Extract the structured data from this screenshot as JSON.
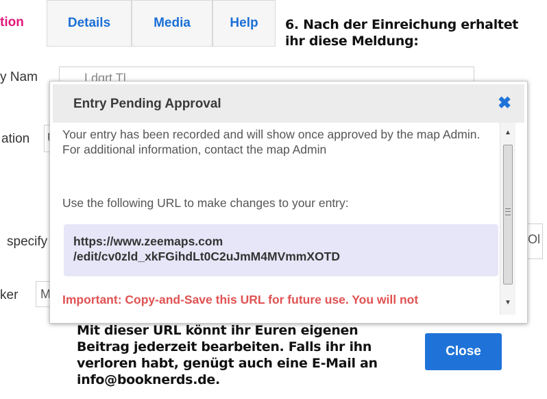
{
  "tabs": [
    {
      "label": "tion",
      "active": true
    },
    {
      "label": "Details",
      "active": false
    },
    {
      "label": "Media",
      "active": false
    },
    {
      "label": "Help",
      "active": false
    }
  ],
  "annotation_top": "6. Nach der Einreichung erhaltet ihr diese Meldung:",
  "annotation_bottom": "Mit dieser URL könnt ihr Euren eigenen Beitrag jederzeit bearbeiten. Falls ihr ihn verloren habt, genügt auch eine E-Mail an info@booknerds.de.",
  "form": {
    "name_label": "y Nam",
    "name_value": "Ldgrt Tl...",
    "location_label": "ation",
    "location_value": "U",
    "specify_label": "specify",
    "specify_value": "Ol",
    "marker_label": "ker",
    "marker_value": "M"
  },
  "dialog": {
    "title": "Entry Pending Approval",
    "close_icon": "close-icon",
    "intro": "Your entry has been recorded and will show once approved by the map Admin. For additional information, contact the map Admin",
    "url_intro": "Use the following URL to make changes to your entry:",
    "url_line1": "https://www.zeemaps.com",
    "url_line2": "/edit/cv0zld_xkFGihdLt0C2uJmM4MVmmXOTD",
    "important": "Important: Copy-and-Save this URL for future use. You will not",
    "close_button": "Close"
  },
  "colors": {
    "accent": "#1f73d8",
    "active_tab": "#e0197a",
    "important": "#e05252",
    "url_box": "#e6e6f8"
  }
}
